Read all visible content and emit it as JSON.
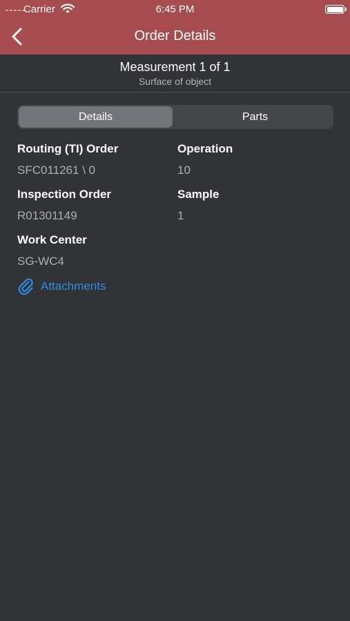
{
  "status_bar": {
    "carrier": "Carrier",
    "time": "6:45 PM"
  },
  "nav": {
    "title": "Order Details"
  },
  "header": {
    "title": "Measurement 1 of 1",
    "subtitle": "Surface of object"
  },
  "tabs": [
    {
      "label": "Details",
      "selected": true
    },
    {
      "label": "Parts",
      "selected": false
    }
  ],
  "fields": {
    "routing_order": {
      "label": "Routing (TI) Order",
      "value": "SFC011261 \\ 0"
    },
    "operation": {
      "label": "Operation",
      "value": "10"
    },
    "inspection_order": {
      "label": "Inspection Order",
      "value": "R01301149"
    },
    "sample": {
      "label": "Sample",
      "value": "1"
    },
    "work_center": {
      "label": "Work Center",
      "value": "SG-WC4"
    }
  },
  "attachments": {
    "label": "Attachments",
    "icon": "paperclip-icon"
  },
  "colors": {
    "nav_bar": "#a64c4e",
    "background": "#323336",
    "link": "#2f8ce3",
    "value_text": "#aeafb2"
  }
}
